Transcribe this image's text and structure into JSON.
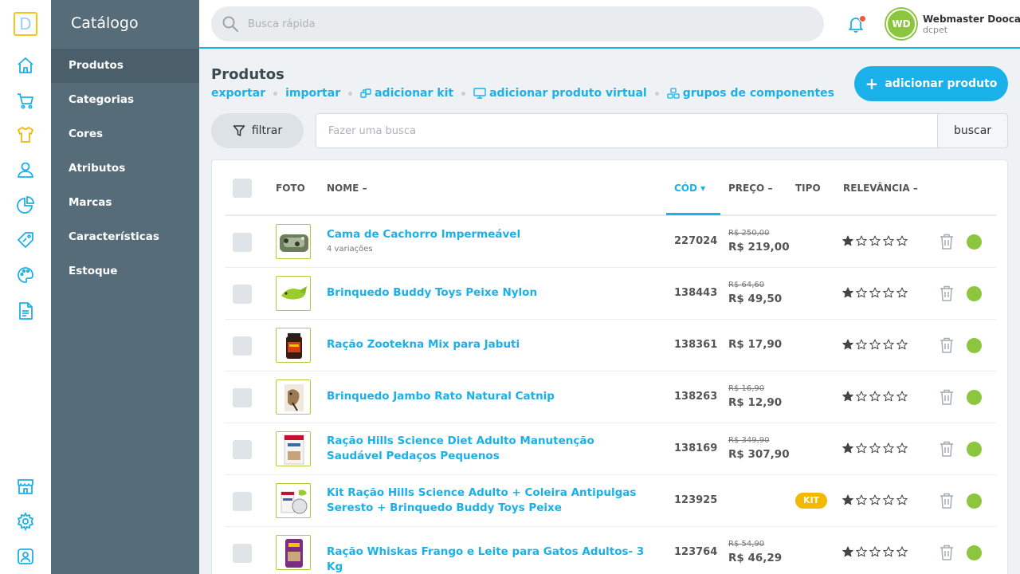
{
  "rail": {
    "logo": "D",
    "top_icons": [
      "home-icon",
      "cart-icon",
      "shirt-icon",
      "customer-icon",
      "report-icon",
      "tag-icon",
      "palette-icon",
      "document-icon"
    ],
    "bottom_icons": [
      "store-icon",
      "gear-icon",
      "user-icon"
    ]
  },
  "sidebar": {
    "title": "Catálogo",
    "items": [
      {
        "label": "Produtos",
        "active": true
      },
      {
        "label": "Categorias"
      },
      {
        "label": "Cores"
      },
      {
        "label": "Atributos"
      },
      {
        "label": "Marcas"
      },
      {
        "label": "Características"
      },
      {
        "label": "Estoque"
      }
    ]
  },
  "topbar": {
    "search_placeholder": "Busca rápida",
    "user": {
      "initials": "WD",
      "name": "Webmaster Dooca",
      "store": "dcpet"
    }
  },
  "page": {
    "title": "Produtos",
    "actions": [
      {
        "label": "exportar"
      },
      {
        "label": "importar"
      },
      {
        "label": "adicionar kit",
        "icon": "kit-icon"
      },
      {
        "label": "adicionar produto virtual",
        "icon": "monitor-icon"
      },
      {
        "label": "grupos de componentes",
        "icon": "components-icon"
      }
    ],
    "add_button": "adicionar produto",
    "filter_button": "filtrar",
    "query_placeholder": "Fazer uma busca",
    "query_button": "buscar"
  },
  "table": {
    "columns": {
      "foto": "FOTO",
      "nome": "NOME",
      "cod": "CÓD",
      "preco": "PREÇO",
      "tipo": "TIPO",
      "relevancia": "RELEVÂNCIA"
    },
    "rows": [
      {
        "name": "Cama de Cachorro Impermeável",
        "variations": "4 variações",
        "code": "227024",
        "old_price": "R$ 250,00",
        "price": "R$ 219,00",
        "type": "",
        "rating": 1,
        "status_color": "#8cc63f"
      },
      {
        "name": "Brinquedo Buddy Toys Peixe Nylon",
        "variations": "",
        "code": "138443",
        "old_price": "R$ 64,60",
        "price": "R$ 49,50",
        "type": "",
        "rating": 1,
        "status_color": "#8cc63f"
      },
      {
        "name": "Ração Zootekna Mix para Jabuti",
        "variations": "",
        "code": "138361",
        "old_price": "",
        "price": "R$ 17,90",
        "type": "",
        "rating": 1,
        "status_color": "#8cc63f"
      },
      {
        "name": "Brinquedo Jambo Rato Natural Catnip",
        "variations": "",
        "code": "138263",
        "old_price": "R$ 16,90",
        "price": "R$ 12,90",
        "type": "",
        "rating": 1,
        "status_color": "#8cc63f"
      },
      {
        "name": "Ração Hills Science Diet Adulto Manutenção Saudável Pedaços Pequenos",
        "variations": "",
        "code": "138169",
        "old_price": "R$ 349,90",
        "price": "R$ 307,90",
        "type": "",
        "rating": 1,
        "status_color": "#8cc63f"
      },
      {
        "name": "Kit Ração Hills Science Adulto + Coleira Antipulgas Seresto + Brinquedo Buddy Toys Peixe",
        "variations": "",
        "code": "123925",
        "old_price": "",
        "price": "",
        "type": "KIT",
        "rating": 1,
        "status_color": "#8cc63f"
      },
      {
        "name": "Ração Whiskas Frango e Leite para Gatos Adultos- 3 Kg",
        "variations": "",
        "code": "123764",
        "old_price": "R$ 54,90",
        "price": "R$ 46,29",
        "type": "",
        "rating": 1,
        "status_color": "#8cc63f"
      }
    ]
  },
  "colors": {
    "accent": "#1ab0ea",
    "sidebar": "#566d79",
    "sidebar_active": "#4a5f6a",
    "status_active": "#8cc63f",
    "kit_badge": "#f5b800",
    "notification": "#ee5a3c",
    "logo_border": "#f5c518"
  }
}
